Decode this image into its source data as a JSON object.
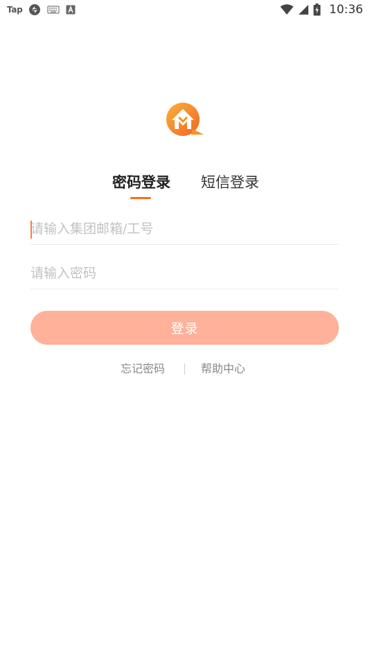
{
  "status_bar": {
    "left_app_label": "Tap",
    "time": "10:36",
    "icons": [
      "tap-app-icon",
      "sync-icon",
      "keyboard-icon",
      "a-font-icon",
      "wifi-icon",
      "cell-signal-icon",
      "battery-charging-icon"
    ]
  },
  "logo": {
    "icon": "house-chat-logo-icon",
    "colors": {
      "orange": "#F7931E",
      "light_orange": "#FBB03B",
      "white": "#FFFFFF"
    }
  },
  "tabs": [
    {
      "label": "密码登录",
      "active": true
    },
    {
      "label": "短信登录",
      "active": false
    }
  ],
  "form": {
    "account_placeholder": "请输入集团邮箱/工号",
    "account_value": "",
    "password_placeholder": "请输入密码",
    "password_value": "",
    "login_label": "登录"
  },
  "links": {
    "forgot_password": "忘记密码",
    "separator": "|",
    "help_center": "帮助中心"
  },
  "colors": {
    "accent": "#FF6A1F",
    "button_disabled": "#FFB199",
    "placeholder": "#C2C2C2",
    "link": "#888888"
  }
}
